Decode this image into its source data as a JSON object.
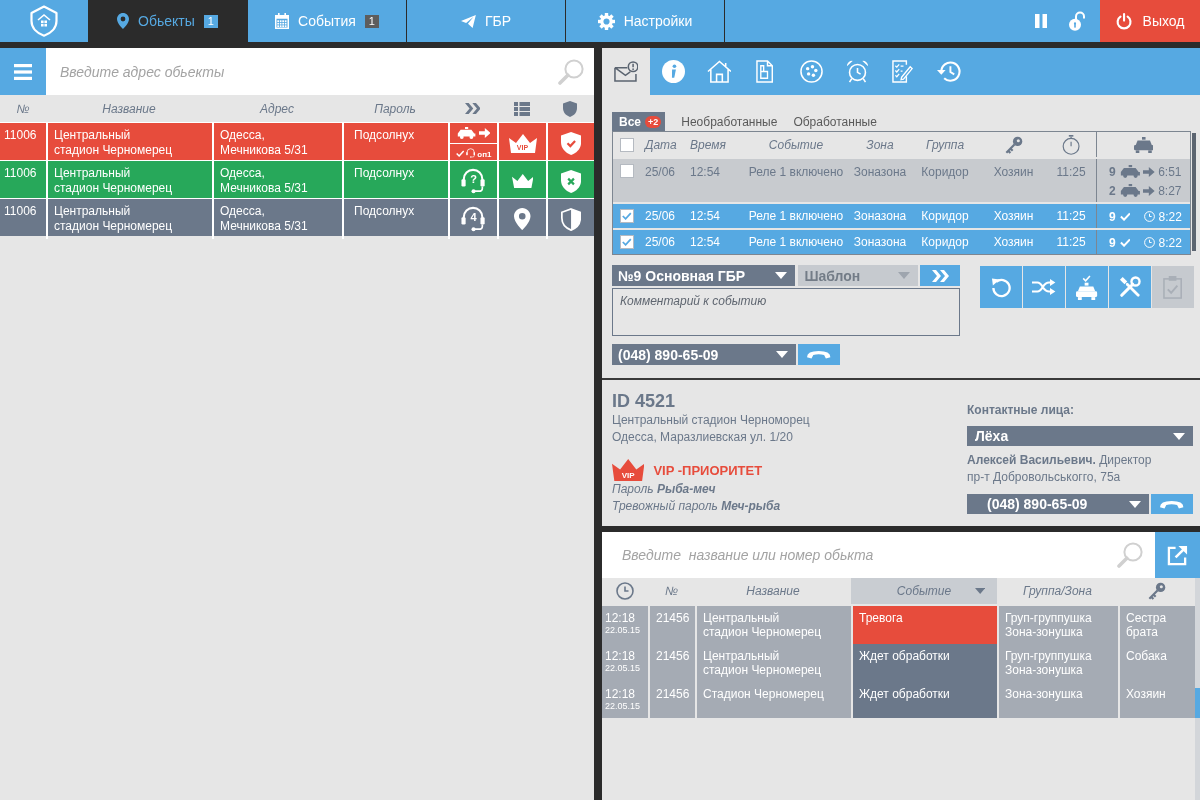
{
  "top_nav": {
    "tabs": [
      {
        "kind": "objects",
        "label": "Обьекты",
        "badge": "1",
        "selected": true
      },
      {
        "kind": "events",
        "label": "События",
        "badge": "1",
        "selected": false
      },
      {
        "kind": "response",
        "label": "ГБР",
        "selected": false
      },
      {
        "kind": "settings",
        "label": "Настройки",
        "selected": false
      }
    ],
    "tools": [
      {
        "kind": "pause"
      },
      {
        "kind": "unlock"
      }
    ],
    "logout": {
      "label": "Выход"
    }
  },
  "objects": {
    "search": {
      "placeholder": "Введите адрес обьекты"
    },
    "columns": [
      "№",
      "Название",
      "Адрес",
      "Пароль"
    ],
    "rows": [
      {
        "color": "#e74c3c",
        "number": "11006",
        "name": "Центральный\nстадион Черномерец",
        "address": "Одесса,\nМечникова 5/31",
        "password": "Подсолнух",
        "response": {
          "kind": "dispatched",
          "operator": "оп1"
        },
        "priority": {
          "kind": "vip",
          "label": "VIP"
        },
        "guard": {
          "kind": "armed"
        }
      },
      {
        "color": "#27a85a",
        "number": "11006",
        "name": "Центральный\nстадион Черномерец",
        "address": "Одесса,\nМечникова 5/31",
        "password": "Подсолнух",
        "response": {
          "kind": "operator",
          "mark": "?"
        },
        "priority": {
          "kind": "crown"
        },
        "guard": {
          "kind": "disarmed"
        }
      },
      {
        "color": "#6b788a",
        "number": "11006",
        "name": "Центральный\nстадион Черномерец",
        "address": "Одесса,\nМечникова 5/31",
        "password": "Подсолнух",
        "response": {
          "kind": "operator",
          "mark": "4"
        },
        "priority": {
          "kind": "location"
        },
        "guard": {
          "kind": "partial"
        }
      }
    ]
  },
  "detail_tabs": [
    {
      "kind": "alerts",
      "selected": true
    },
    {
      "kind": "info",
      "selected": false
    },
    {
      "kind": "object",
      "selected": false
    },
    {
      "kind": "plan",
      "selected": false
    },
    {
      "kind": "sensors",
      "selected": false
    },
    {
      "kind": "alarm",
      "selected": false
    },
    {
      "kind": "tasks",
      "selected": false
    },
    {
      "kind": "history",
      "selected": false
    }
  ],
  "events": {
    "filters": [
      {
        "label": "Все",
        "badge": "+2",
        "selected": true
      },
      {
        "label": "Необработанные",
        "selected": false
      },
      {
        "label": "Обработанные",
        "selected": false
      }
    ],
    "select_all": {
      "checked": false
    },
    "columns": [
      "Дата",
      "Время",
      "Событие",
      "Зона",
      "Группа"
    ],
    "rows": [
      {
        "checked": false,
        "selected": false,
        "date": "25/06",
        "time": "12:54",
        "event": "Реле 1 включено",
        "zone": "Зоназона",
        "group": "Коридор",
        "contact": "Хозяин",
        "duration": "11:25",
        "units": [
          {
            "kind": "en_route",
            "crew": "9",
            "time": "6:51"
          },
          {
            "kind": "en_route",
            "crew": "2",
            "time": "8:27"
          }
        ]
      },
      {
        "checked": true,
        "selected": true,
        "date": "25/06",
        "time": "12:54",
        "event": "Реле 1 включено",
        "zone": "Зоназона",
        "group": "Коридор",
        "contact": "Хозяин",
        "duration": "11:25",
        "units": [
          {
            "kind": "arrived",
            "crew": "9",
            "time": "8:22"
          }
        ]
      },
      {
        "checked": true,
        "selected": true,
        "date": "25/06",
        "time": "12:54",
        "event": "Реле 1 включено",
        "zone": "Зоназона",
        "group": "Коридор",
        "contact": "Хозяин",
        "duration": "11:25",
        "units": [
          {
            "kind": "arrived",
            "crew": "9",
            "time": "8:22"
          }
        ]
      }
    ]
  },
  "dispatch": {
    "crew": {
      "value": "№9 Основная ГБР"
    },
    "template": {
      "value": "Шаблон",
      "disabled": true
    },
    "comment": {
      "placeholder": "Комментарий к событию"
    },
    "phone": {
      "value": "(048) 890-65-09"
    }
  },
  "actions": [
    {
      "kind": "refresh",
      "disabled": false
    },
    {
      "kind": "shuffle",
      "disabled": false
    },
    {
      "kind": "dispatch_car",
      "disabled": false
    },
    {
      "kind": "tools",
      "disabled": false
    },
    {
      "kind": "confirm",
      "disabled": true
    }
  ],
  "object_card": {
    "id": "ID 4521",
    "name": "Центральный стадион Черноморец",
    "address": "Одесса, Маразлиевская ул. 1/20",
    "vip": {
      "badge": "VIP",
      "label": "VIP -ПРИОРИТЕТ"
    },
    "password": "Пароль **Рыба-меч**",
    "alarm_password": "Тревожный пароль **Меч-рыба**",
    "contacts": {
      "title": "Контактные лица:",
      "person_select": {
        "value": "Лёха"
      },
      "person": "**Алексей Васильевич.** Директор",
      "address": "пр-т Добровольськогго, 75а",
      "phone": {
        "value": "(048) 890-65-09"
      }
    }
  },
  "monitor": {
    "search": {
      "placeholder": "Введите  название или номер обькта"
    },
    "columns": [
      {
        "label": "№",
        "sorted": false
      },
      {
        "label": "Название",
        "sorted": false
      },
      {
        "label": "Событие",
        "sorted": true
      },
      {
        "label": "Группа/Зона",
        "sorted": false
      }
    ],
    "rows": [
      {
        "time": "12:18",
        "date": "22.05.15",
        "number": "21456",
        "name": "Центральный\nстадион Черномерец",
        "event": {
          "label": "Тревога",
          "color": "#e74c3c"
        },
        "group_zone": "Груп-группушка\nЗона-зонушка",
        "contact": "Сестра\nбрата"
      },
      {
        "time": "12:18",
        "date": "22.05.15",
        "number": "21456",
        "name": "Центральный\nстадион Черномерец",
        "event": {
          "label": "Ждет обработки",
          "color": "#6b788a"
        },
        "group_zone": "Груп-группушка\nЗона-зонушка",
        "contact": "Собака"
      },
      {
        "time": "12:18",
        "date": "22.05.15",
        "number": "21456",
        "name": "Стадион Черномерец",
        "event": {
          "label": "Ждет обработки",
          "color": "#6b788a"
        },
        "group_zone": "Зона-зонушка",
        "contact": "Хозяин"
      }
    ]
  }
}
